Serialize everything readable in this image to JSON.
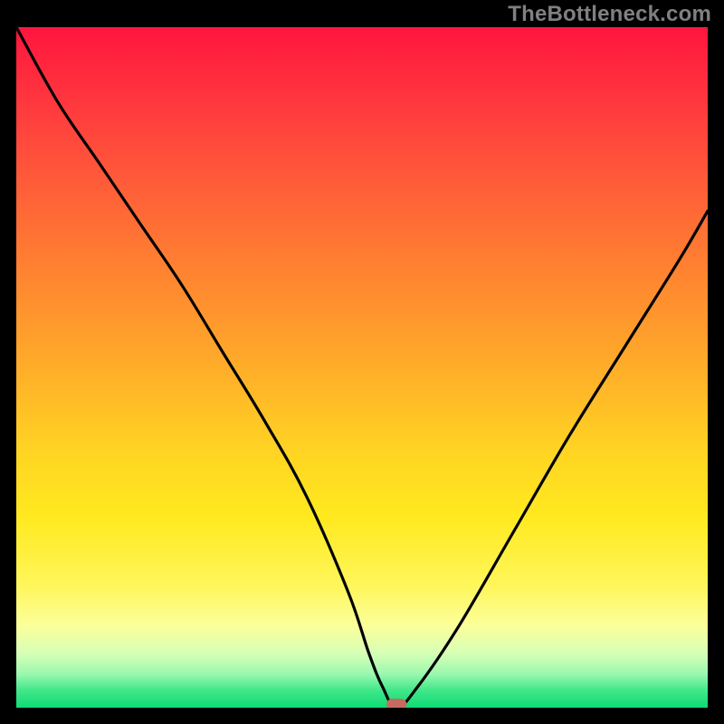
{
  "watermark": "TheBottleneck.com",
  "chart_data": {
    "type": "line",
    "title": "",
    "xlabel": "",
    "ylabel": "",
    "xlim": [
      0,
      100
    ],
    "ylim": [
      0,
      100
    ],
    "grid": false,
    "series": [
      {
        "name": "bottleneck-curve",
        "x": [
          0,
          6,
          12,
          18,
          24,
          30,
          36,
          42,
          48,
          51,
          53,
          55,
          58,
          64,
          72,
          80,
          88,
          96,
          100
        ],
        "values": [
          100,
          89,
          80,
          71,
          62,
          52,
          42,
          31,
          17,
          8,
          3,
          0,
          3,
          12,
          26,
          40,
          53,
          66,
          73
        ]
      }
    ],
    "marker": {
      "x": 55,
      "y": 0
    },
    "background_gradient_stops": [
      {
        "pos": 0.0,
        "color": "#ff153e"
      },
      {
        "pos": 0.3,
        "color": "#ff7134"
      },
      {
        "pos": 0.62,
        "color": "#ffd323"
      },
      {
        "pos": 0.88,
        "color": "#fbff9b"
      },
      {
        "pos": 1.0,
        "color": "#0edb75"
      }
    ]
  }
}
